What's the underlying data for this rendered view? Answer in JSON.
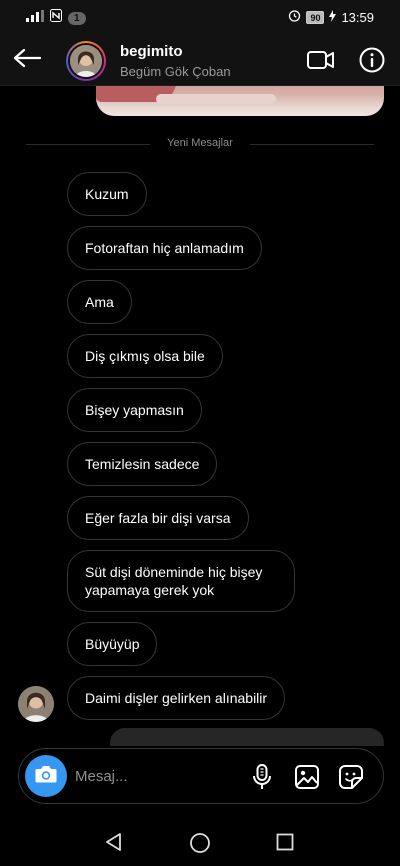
{
  "status_bar": {
    "notification_count": "1",
    "battery": "90",
    "time": "13:59"
  },
  "header": {
    "username": "begimito",
    "full_name": "Begüm Gök Çoban"
  },
  "chat": {
    "divider_label": "Yeni Mesajlar",
    "messages": [
      "Kuzum",
      "Fotoraftan hiç anlamadım",
      "Ama",
      "Diş çıkmış olsa bile",
      "Bişey yapmasın",
      "Temizlesin sadece",
      "Eğer fazla bir dişi varsa",
      "Süt dişi döneminde hiç bişey yapamaya gerek yok",
      "Büyüyüp",
      "Daimi dişler gelirken alınabilir"
    ]
  },
  "composer": {
    "placeholder": "Mesaj..."
  },
  "colors": {
    "background": "#000000",
    "bar_background": "#121212",
    "bubble_border": "#363636",
    "camera_button": "#3797f0",
    "secondary_text": "#8e8e8e"
  },
  "icons": {
    "back": "arrow-left-icon",
    "video": "video-camera-icon",
    "info": "info-circle-icon",
    "camera": "camera-icon",
    "mic": "microphone-icon",
    "gallery": "gallery-icon",
    "sticker": "sticker-icon"
  }
}
